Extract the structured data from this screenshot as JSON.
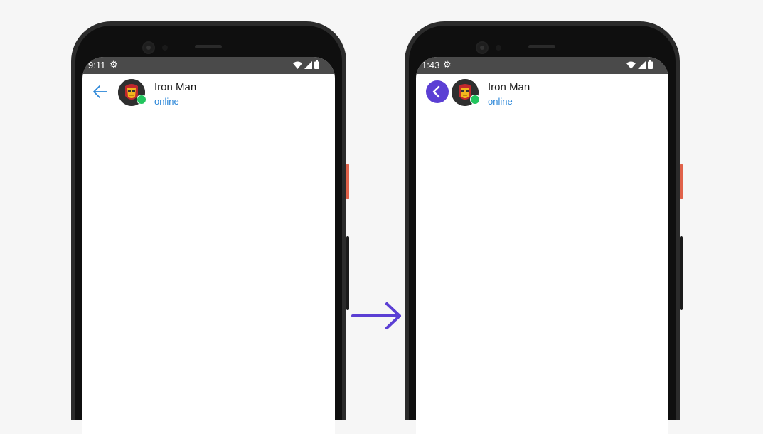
{
  "phones": [
    {
      "status_time": "9:11",
      "back_style": "arrow",
      "contact": {
        "name": "Iron Man",
        "status": "online"
      }
    },
    {
      "status_time": "1:43",
      "back_style": "circle-chevron",
      "contact": {
        "name": "Iron Man",
        "status": "online"
      }
    }
  ],
  "colors": {
    "back_arrow": "#2a86d8",
    "back_circle": "#5b3fd4",
    "online": "#22c55e",
    "transition_arrow": "#5b3fd4"
  },
  "icons": {
    "status_settings": "gear-icon",
    "status_wifi": "wifi-icon",
    "status_signal": "signal-icon",
    "status_battery": "battery-icon",
    "transition": "arrow-right-icon"
  }
}
